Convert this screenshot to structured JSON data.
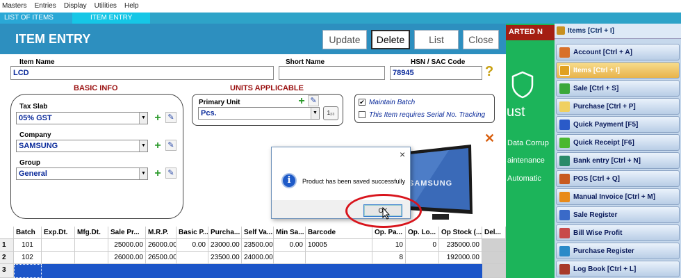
{
  "menu": [
    "Masters",
    "Entries",
    "Display",
    "Utilities",
    "Help"
  ],
  "tabs": {
    "list": "LIST OF ITEMS",
    "entry": "ITEM ENTRY"
  },
  "window": {
    "title": "ITEM ENTRY",
    "buttons": {
      "update": "Update",
      "delete": "Delete",
      "list": "List",
      "close": "Close"
    }
  },
  "form": {
    "item_name_label": "Item Name",
    "item_name": "LCD",
    "short_name_label": "Short Name",
    "short_name": "",
    "hsn_label": "HSN / SAC Code",
    "hsn": "78945",
    "help_glyph": "?",
    "basic_info_title": "BASIC INFO",
    "tax_slab_label": "Tax Slab",
    "tax_slab": "05% GST",
    "company_label": "Company",
    "company": "SAMSUNG",
    "group_label": "Group",
    "group": "General",
    "units_title": "UNITS APPLICABLE",
    "primary_unit_label": "Primary Unit",
    "primary_unit": "Pcs.",
    "unit_conv_glyph": "1₂₃",
    "maintain_batch_label": "Maintain Batch",
    "maintain_batch_checked": "✔",
    "serial_label": "This Item requires Serial No. Tracking"
  },
  "grid": {
    "columns": [
      "Batch",
      "Exp.Dt.",
      "Mfg.Dt.",
      "Sale Pr...",
      "M.R.P.",
      "Basic P...",
      "Purcha...",
      "Self Va...",
      "Min Sa...",
      "Barcode",
      "Op. Pa...",
      "Op. Lo...",
      "Op Stock (...",
      "Del..."
    ],
    "rows": [
      {
        "no": "1",
        "cells": [
          "101",
          "",
          "",
          "25000.00",
          "26000.00",
          "0.00",
          "23000.00",
          "23500.00",
          "0.00",
          "10005",
          "10",
          "0",
          "235000.00",
          ""
        ]
      },
      {
        "no": "2",
        "cells": [
          "102",
          "",
          "",
          "26000.00",
          "26500.00",
          "",
          "23500.00",
          "24000.00",
          "",
          "",
          "8",
          "",
          "192000.00",
          ""
        ]
      },
      {
        "no": "3",
        "cells": [
          "",
          "",
          "",
          "",
          "",
          "",
          "",
          "",
          "",
          "",
          "",
          "",
          "",
          ""
        ]
      }
    ]
  },
  "dialog": {
    "close_glyph": "×",
    "message": "Product has been saved successfully",
    "ok_label": "OK",
    "info_glyph": "i"
  },
  "tv_brand": "SAMSUNG",
  "promo": {
    "banner": "ARTED N",
    "line1": "ust",
    "line2": "Data Corrup",
    "line3": "aintenance",
    "line4": "Automatic"
  },
  "sidebar": {
    "header": "Items [Ctrl + I]",
    "items": [
      {
        "label": "Account [Ctrl + A]",
        "icon": "account-icon",
        "color": "#d8702a"
      },
      {
        "label": "Items [Ctrl + I]",
        "icon": "items-icon",
        "color": "#e0a020"
      },
      {
        "label": "Sale [Ctrl + S]",
        "icon": "sale-icon",
        "color": "#3aa83a"
      },
      {
        "label": "Purchase [Ctrl + P]",
        "icon": "purchase-icon",
        "color": "#f0d060"
      },
      {
        "label": "Quick Payment [F5]",
        "icon": "quick-payment-icon",
        "color": "#2a5ac8"
      },
      {
        "label": "Quick Receipt [F6]",
        "icon": "quick-receipt-icon",
        "color": "#4ab830"
      },
      {
        "label": "Bank entry [Ctrl + N]",
        "icon": "bank-entry-icon",
        "color": "#2a8a6a"
      },
      {
        "label": "POS [Ctrl + Q]",
        "icon": "pos-icon",
        "color": "#c85a20"
      },
      {
        "label": "Manual Invoice [Ctrl + M]",
        "icon": "manual-invoice-icon",
        "color": "#e88a1a"
      },
      {
        "label": "Sale Register",
        "icon": "sale-register-icon",
        "color": "#3a6ac8"
      },
      {
        "label": "Bill Wise Profit",
        "icon": "bill-wise-profit-icon",
        "color": "#c84a4a"
      },
      {
        "label": "Purchase Register",
        "icon": "purchase-register-icon",
        "color": "#2a8ac8"
      },
      {
        "label": "Log Book [Ctrl + L]",
        "icon": "log-book-icon",
        "color": "#a83a2a"
      }
    ]
  },
  "colors": {
    "header_blue": "#2d8fbf",
    "selected_row": "#1c55c8",
    "annotation_red": "#d8141c",
    "promo_green": "#1cb45a"
  }
}
